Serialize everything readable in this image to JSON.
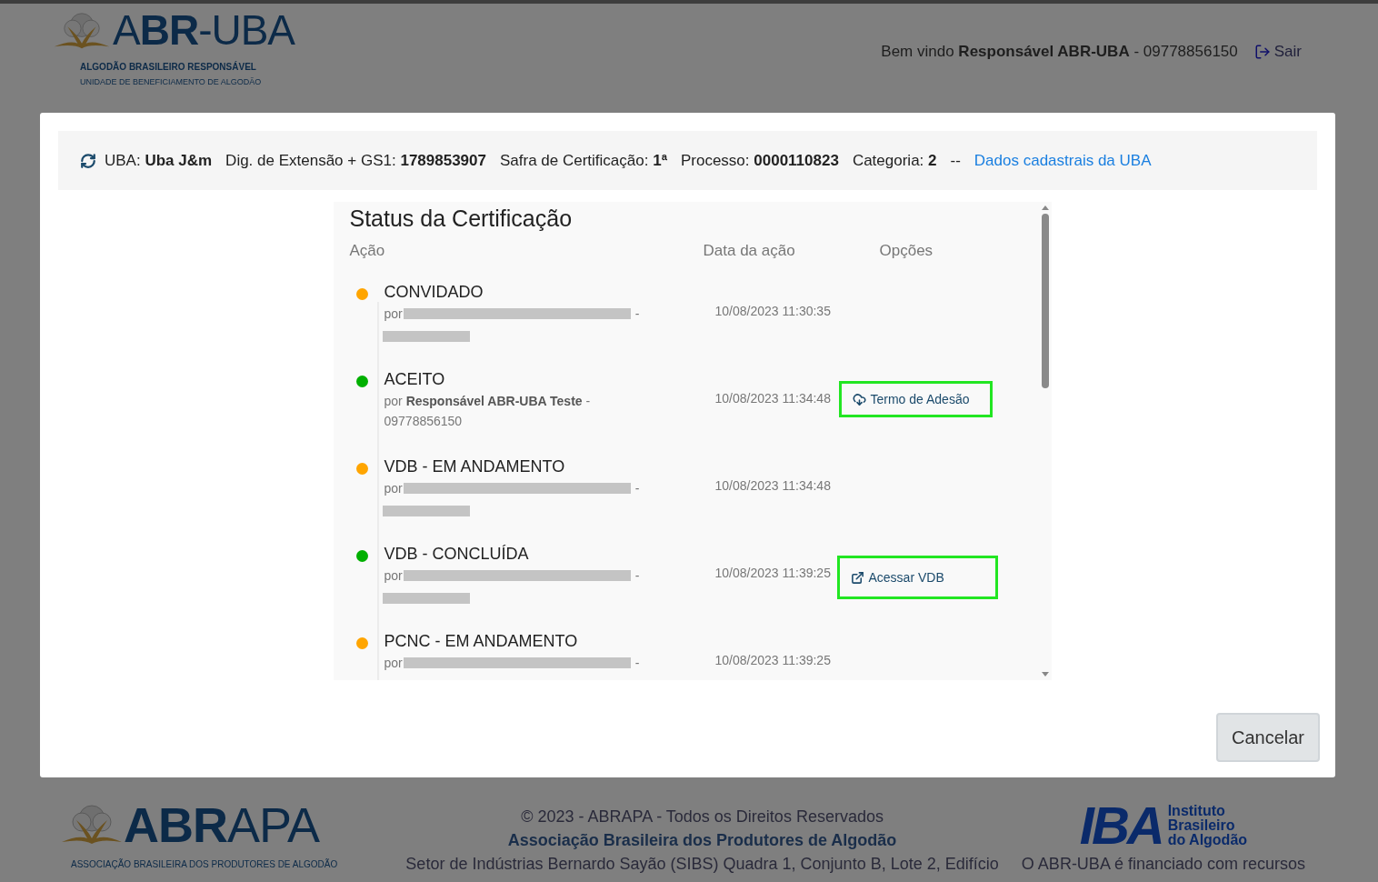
{
  "header": {
    "logo": {
      "title_light": "A",
      "title_bold": "BR",
      "title_rest": "-UBA",
      "line1": "ALGODÃO BRASILEIRO RESPONSÁVEL",
      "line2": "UNIDADE DE BENEFICIAMENTO DE ALGODÃO"
    },
    "welcome": "Bem vindo **Responsável ABR-UBA** - 09778856150",
    "logout": "Sair"
  },
  "info_bar": {
    "items": [
      {
        "label": "UBA:",
        "value": "Uba J&m"
      },
      {
        "label": "Dig. de Extensão + GS1:",
        "value": "1789853907"
      },
      {
        "label": "Safra de Certificação:",
        "value": "1ª"
      },
      {
        "label": "Processo:",
        "value": "0000110823"
      },
      {
        "label": "Categoria:",
        "value": "2"
      }
    ],
    "separator": "--",
    "link": "Dados cadastrais da UBA"
  },
  "status": {
    "title": "Status da Certificação",
    "columns": [
      "Ação",
      "Data da ação",
      "Opções"
    ],
    "entries": [
      {
        "action": "CONVIDADO",
        "color": "#ffa500",
        "prefix": "por",
        "redacted": true,
        "suffix": "-",
        "date": "10/08/2023 11:30:35"
      },
      {
        "action": "ACEITO",
        "color": "#00b000",
        "prefix": "por",
        "redacted": false,
        "name": "Responsável ABR-UBA Teste",
        "suffix": "-",
        "id": "09778856150",
        "date": "10/08/2023 11:34:48",
        "option": {
          "kind": "download",
          "label": "Termo de Adesão",
          "highlighted": true
        }
      },
      {
        "action": "VDB - EM ANDAMENTO",
        "color": "#ffa500",
        "prefix": "por",
        "redacted": true,
        "suffix": "-",
        "date": "10/08/2023 11:34:48"
      },
      {
        "action": "VDB - CONCLUÍDA",
        "color": "#00b000",
        "prefix": "por",
        "redacted": true,
        "suffix": "-",
        "date": "10/08/2023 11:39:25",
        "option": {
          "kind": "external",
          "label": "Acessar VDB",
          "highlighted": true
        }
      },
      {
        "action": "PCNC - EM ANDAMENTO",
        "color": "#ffa500",
        "prefix": "por",
        "redacted": true,
        "suffix": "-",
        "date": "10/08/2023 11:39:25"
      }
    ]
  },
  "cancel": "Cancelar",
  "footer": {
    "abrapa": {
      "title_bold": "ABR",
      "title_rest": "APA",
      "tagline": "ASSOCIAÇÃO BRASILEIRA DOS PRODUTORES DE ALGODÃO"
    },
    "lines": [
      "© 2023 - ABRAPA - Todos os Direitos Reservados",
      "**Associação Brasileira dos Produtores de Algodão**",
      "Setor de Indústrias Bernardo Sayão (SIBS) Quadra 1, Conjunto B, Lote 2, Edifício"
    ],
    "iba": {
      "mark": "IBA",
      "name": [
        "Instituto",
        "Brasileiro",
        "do Algodão"
      ],
      "text": "O ABR-UBA é financiado com recursos"
    }
  }
}
